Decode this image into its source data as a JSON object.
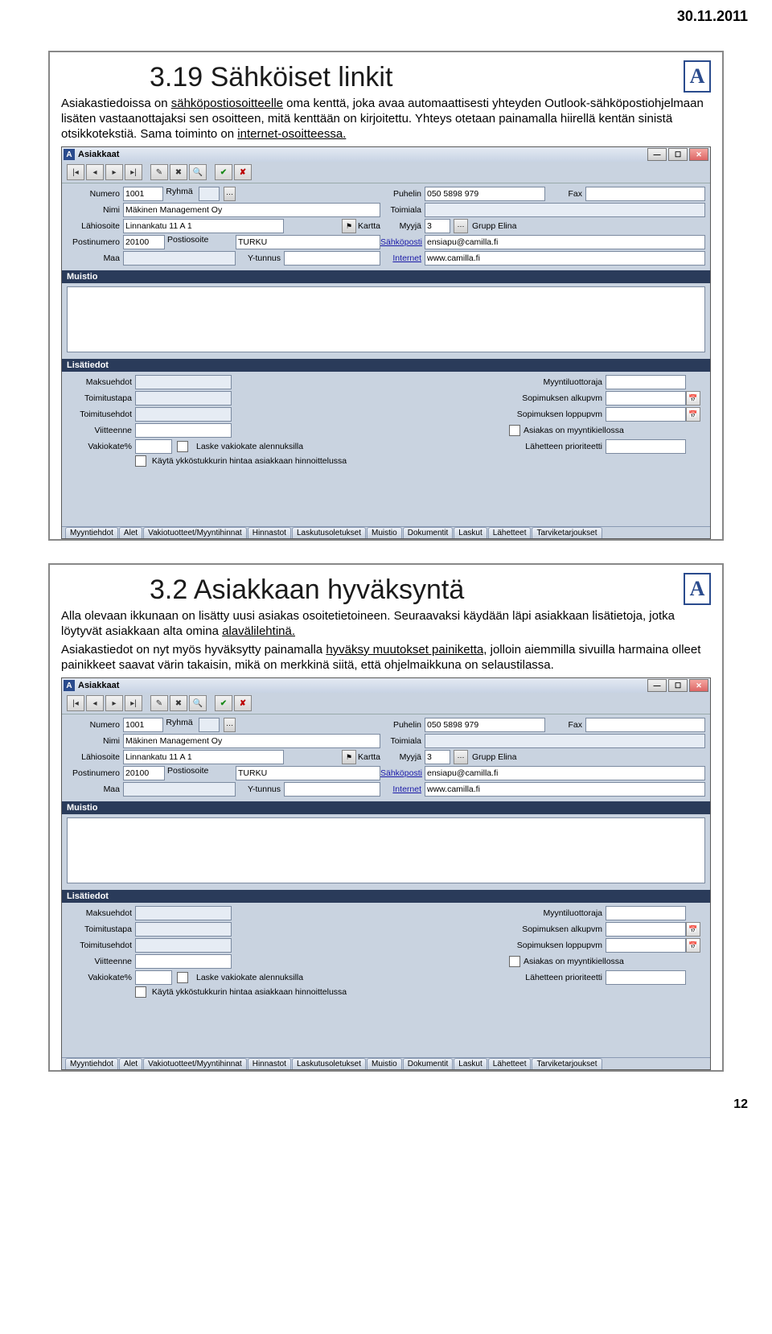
{
  "page_date": "30.11.2011",
  "page_number": "12",
  "logo_letter": "A",
  "slide1": {
    "title": "3.19 Sähköiset linkit",
    "para1a": "Asiakastiedoissa on ",
    "para1_u1": "sähköpostiosoitteelle",
    "para1b": " oma kenttä, joka avaa automaattisesti yhteyden Outlook-sähköpostiohjelmaan lisäten vastaanottajaksi sen osoitteen, mitä kenttään on kirjoitettu. Yhteys otetaan painamalla hiirellä kentän sinistä otsikkotekstiä. Sama toiminto on ",
    "para1_u2": "internet-osoitteessa."
  },
  "slide2": {
    "title": "3.2 Asiakkaan hyväksyntä",
    "para1": "Alla olevaan ikkunaan on lisätty uusi asiakas osoitetietoineen. Seuraavaksi käydään läpi asiakkaan lisätietoja, jotka löytyvät asiakkaan alta omina ",
    "para1_u1": "alavälilehtinä.",
    "para2a": "Asiakastiedot on nyt myös hyväksytty painamalla ",
    "para2_u1": "hyväksy muutokset painiketta,",
    "para2b": " jolloin aiemmilla sivuilla harmaina olleet painikkeet saavat värin takaisin, mikä on merkkinä siitä, että ohjelmaikkuna on selaustilassa."
  },
  "win": {
    "title": "Asiakkaat",
    "fields": {
      "numero_l": "Numero",
      "numero_v": "1001",
      "ryhma_l": "Ryhmä",
      "puhelin_l": "Puhelin",
      "puhelin_v": "050 5898 979",
      "fax_l": "Fax",
      "nimi_l": "Nimi",
      "nimi_v": "Mäkinen Management Oy",
      "toimiala_l": "Toimiala",
      "lahi_l": "Lähiosoite",
      "lahi_v": "Linnankatu 11 A 1",
      "kartta_l": "Kartta",
      "myyja_l": "Myyjä",
      "myyja_v": "3",
      "grupp_l": "Grupp Elina",
      "postinro_l": "Postinumero",
      "postinro_v": "20100",
      "postios_l": "Postiosoite",
      "postios_v": "TURKU",
      "sahkop_l": "Sähköposti",
      "sahkop_v": "ensiapu@camilla.fi",
      "maa_l": "Maa",
      "ytunnus_l": "Y-tunnus",
      "internet_l": "Internet",
      "internet_v": "www.camilla.fi"
    },
    "muistio": "Muistio",
    "lisatiedot": "Lisätiedot",
    "lt": {
      "maksuehdot": "Maksuehdot",
      "myyntiluotto": "Myyntiluottoraja",
      "toimitustapa": "Toimitustapa",
      "sop_alku": "Sopimuksen alkupvm",
      "toimitusehdot": "Toimitusehdot",
      "sop_loppu": "Sopimuksen loppupvm",
      "viitteenne": "Viitteenne",
      "asiakas_kielto": "Asiakas on myyntikiellossa",
      "vakiokate": "Vakiokate%",
      "laske_vakio": "Laske vakiokate alennuksilla",
      "lahetteen": "Lähetteen prioriteetti",
      "kayta_yk": "Käytä ykköstukkurin hintaa asiakkaan hinnoittelussa"
    },
    "tabs": [
      "Myyntiehdot",
      "Alet",
      "Vakiotuotteet/Myyntihinnat",
      "Hinnastot",
      "Laskutusoletukset",
      "Muistio",
      "Dokumentit",
      "Laskut",
      "Lähetteet",
      "Tarviketarjoukset"
    ]
  }
}
